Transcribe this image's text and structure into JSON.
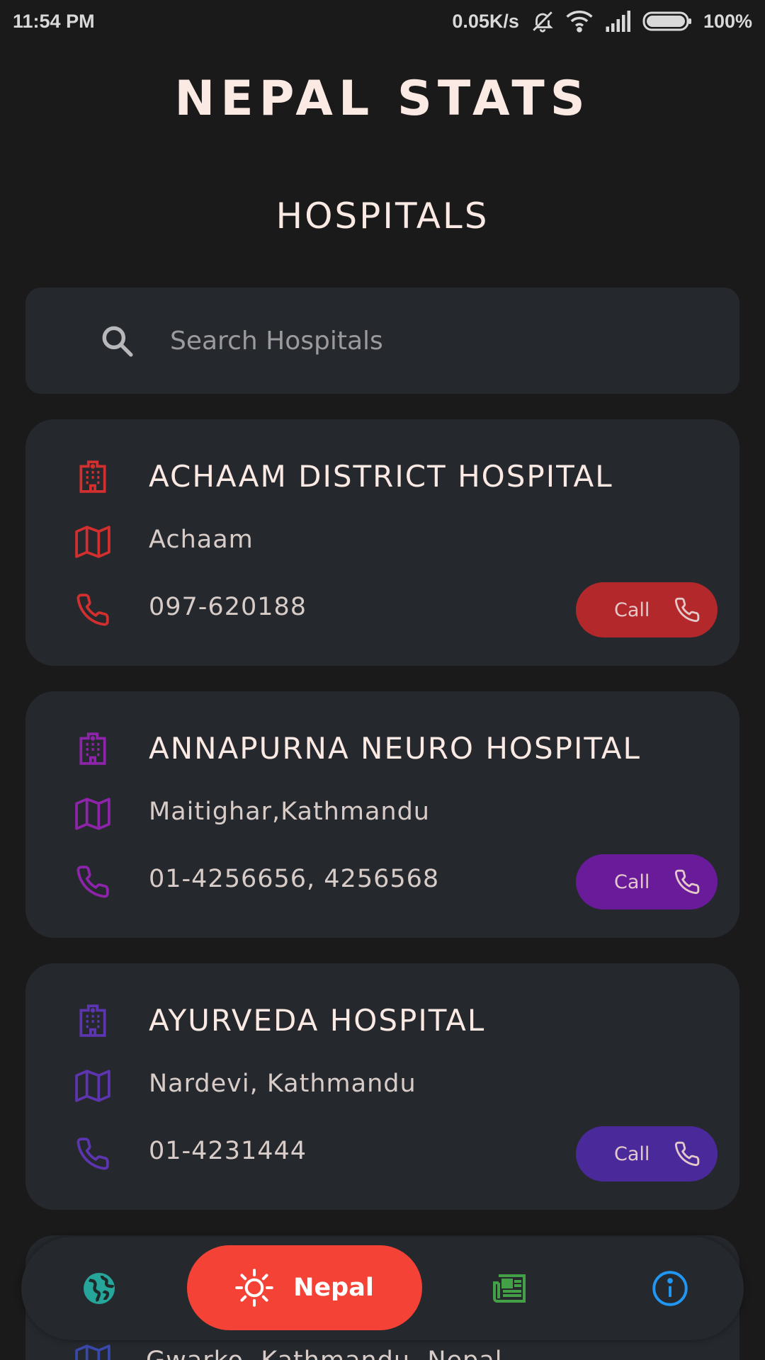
{
  "status_bar": {
    "time": "11:54 PM",
    "net_speed": "0.05K/s",
    "battery": "100%",
    "icons": [
      "mute-bell-icon",
      "wifi-icon",
      "signal-icon",
      "battery-icon"
    ]
  },
  "app": {
    "title": "NEPAL STATS",
    "section": "HOSPITALS"
  },
  "search": {
    "placeholder": "Search Hospitals",
    "value": ""
  },
  "hospitals": [
    {
      "name": "ACHAAM DISTRICT HOSPITAL",
      "address": "Achaam",
      "phone": "097-620188",
      "call_label": "Call",
      "accent": "#d32f2f",
      "button_color": "#b3282b"
    },
    {
      "name": "ANNAPURNA NEURO HOSPITAL",
      "address": "Maitighar,Kathmandu",
      "phone": "01-4256656, 4256568",
      "call_label": "Call",
      "accent": "#8e24aa",
      "button_color": "#6a1b9a"
    },
    {
      "name": "AYURVEDA HOSPITAL",
      "address": "Nardevi, Kathmandu",
      "phone": "01-4231444",
      "call_label": "Call",
      "accent": "#5e35b1",
      "button_color": "#4a2a9a"
    },
    {
      "address": "Gwarko, Kathmandu, Nepal",
      "accent": "#3949ab"
    }
  ],
  "bottom_nav": {
    "items": [
      {
        "icon": "globe-icon",
        "label": "",
        "color": "#26a69a"
      },
      {
        "icon": "sun-icon",
        "label": "Nepal",
        "color": "#f44336",
        "active": true
      },
      {
        "icon": "newspaper-icon",
        "label": "",
        "color": "#43a047"
      },
      {
        "icon": "info-icon",
        "label": "",
        "color": "#2196f3"
      }
    ]
  }
}
